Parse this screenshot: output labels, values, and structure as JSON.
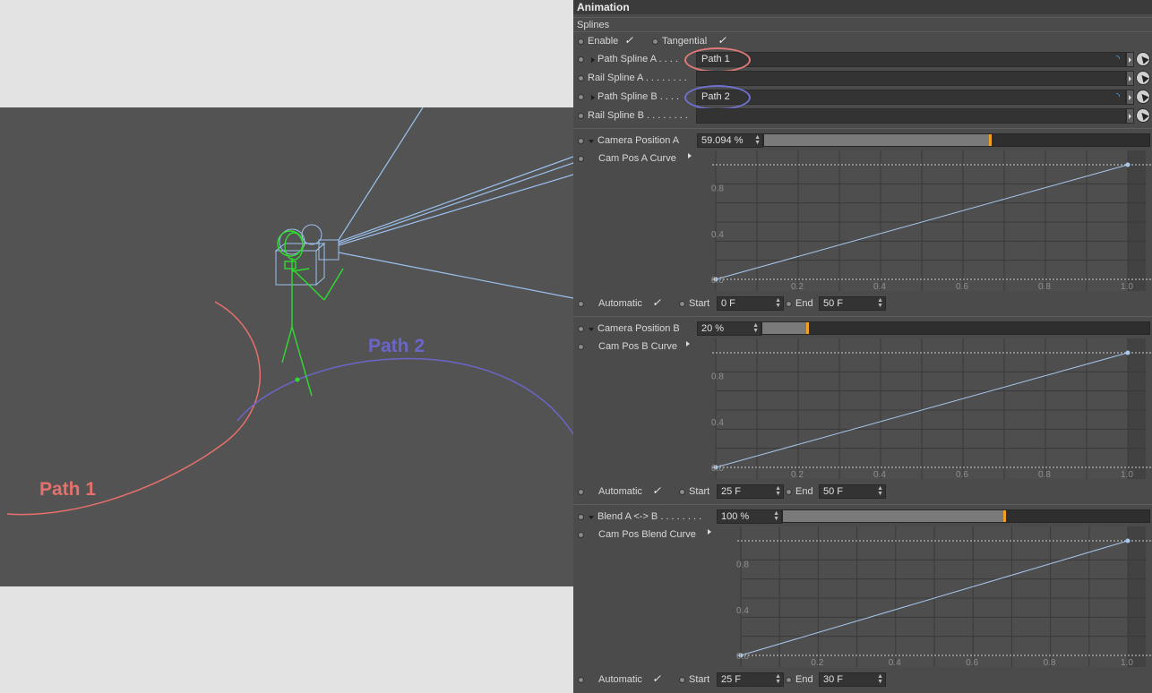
{
  "viewport": {
    "path1_label": "Path 1",
    "path2_label": "Path 2",
    "colors": {
      "path1": "#e5706c",
      "path2": "#6a66c8",
      "camera": "#9cc2ee",
      "figure": "#2fdc2f"
    }
  },
  "panel": {
    "header": "Animation",
    "subheader": "Splines",
    "enable_label": "Enable",
    "tangential_label": "Tangential",
    "check_glyph": "✓",
    "path_spline_a_label": "Path Spline A . . . .",
    "path_spline_a_value": "Path 1",
    "rail_spline_a_label": "Rail Spline A . . . . . . . .",
    "path_spline_b_label": "Path Spline B . . . .",
    "path_spline_b_value": "Path 2",
    "rail_spline_b_label": "Rail Spline B . . . . . . . .",
    "camera_position_a": {
      "label": "Camera Position A",
      "value": "59.094 %",
      "fraction": 0.5909
    },
    "cam_pos_a_curve_label": "Cam Pos A Curve",
    "row_a": {
      "automatic": "Automatic",
      "start_label": "Start",
      "start_value": "0 F",
      "end_label": "End",
      "end_value": "50 F"
    },
    "camera_position_b": {
      "label": "Camera Position B",
      "value": "20 %",
      "fraction": 0.12
    },
    "cam_pos_b_curve_label": "Cam Pos B Curve",
    "row_b": {
      "automatic": "Automatic",
      "start_label": "Start",
      "start_value": "25 F",
      "end_label": "End",
      "end_value": "50 F"
    },
    "blend": {
      "label": "Blend A <-> B . . . . . . . .",
      "value": "100 %",
      "fraction": 0.61
    },
    "cam_pos_blend_curve_label": "Cam Pos Blend Curve",
    "row_blend": {
      "automatic": "Automatic",
      "start_label": "Start",
      "start_value": "25 F",
      "end_label": "End",
      "end_value": "30 F"
    },
    "graph_y_ticks": [
      "0.8",
      "0.4",
      "0.0"
    ],
    "graph_x_ticks": [
      "0.2",
      "0.4",
      "0.6",
      "0.8",
      "1.0"
    ],
    "oval_colors": {
      "a": "#e07a78",
      "b": "#6f70d0"
    }
  }
}
